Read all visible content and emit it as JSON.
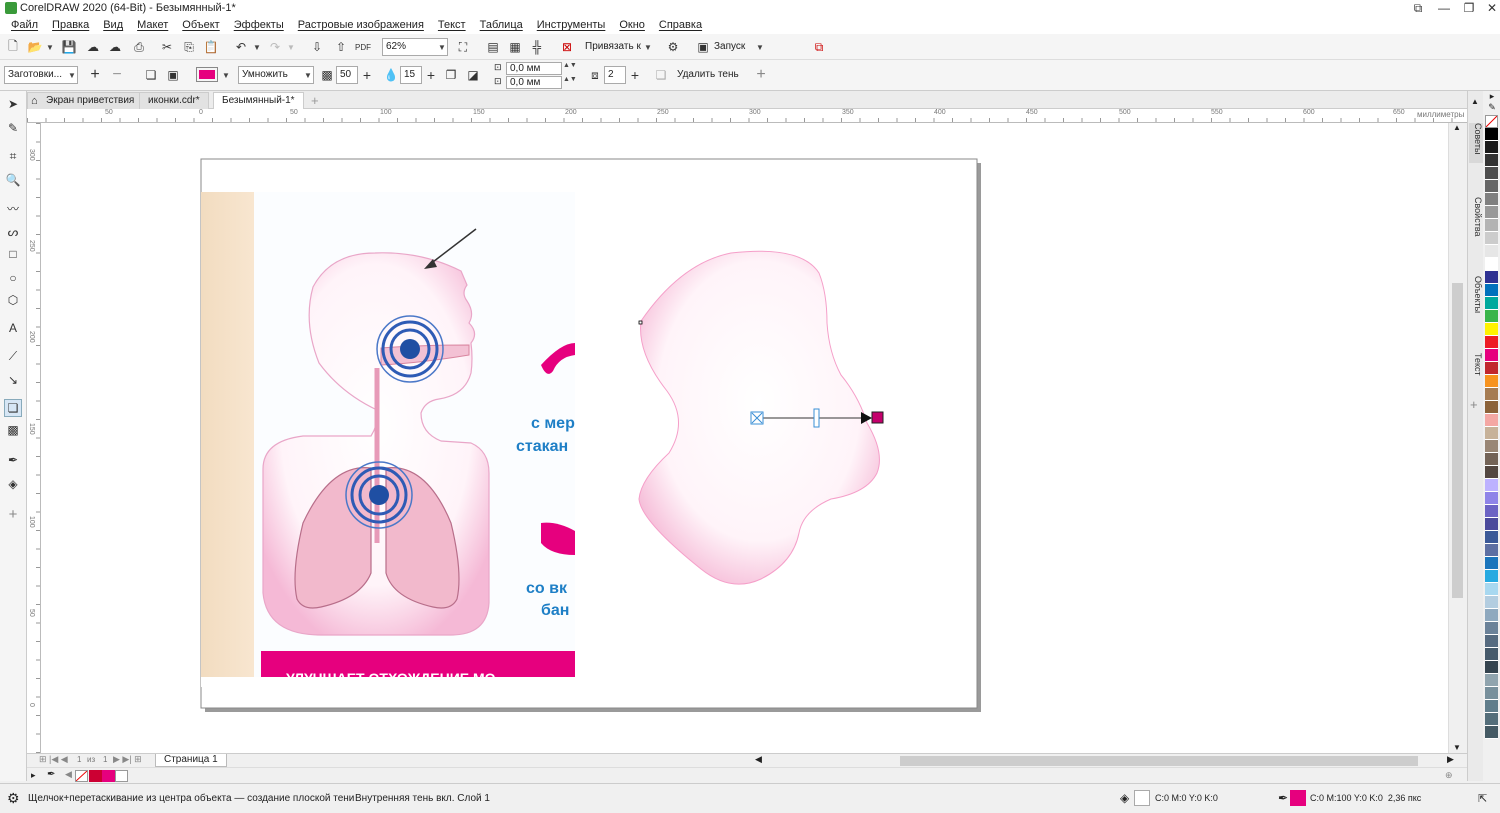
{
  "app": {
    "title": "CorelDRAW 2020 (64-Bit) - Безымянный-1*"
  },
  "menu": [
    "Файл",
    "Правка",
    "Вид",
    "Макет",
    "Объект",
    "Эффекты",
    "Растровые изображения",
    "Текст",
    "Таблица",
    "Инструменты",
    "Окно",
    "Справка"
  ],
  "toolbar1": {
    "zoom": "62%",
    "snap_label": "Привязать к",
    "launch_label": "Запуск"
  },
  "toolbar2": {
    "preset": "Заготовки...",
    "blend_mode": "Умножить",
    "opacity": "50",
    "feather": "15",
    "offset_x": "0,0 мм",
    "offset_y": "0,0 мм",
    "shadow_copies": "2",
    "remove_shadow": "Удалить тень",
    "shadow_color": "#e6007e"
  },
  "tabs": [
    {
      "label": "Экран приветствия"
    },
    {
      "label": "иконки.cdr*"
    },
    {
      "label": "Безымянный-1*"
    }
  ],
  "ruler": {
    "units": "миллиметры",
    "h_ticks": [
      "50",
      "0",
      "50",
      "100",
      "150",
      "200",
      "250",
      "300",
      "350",
      "400",
      "450",
      "500",
      "550",
      "600",
      "650"
    ],
    "v_ticks": [
      "300",
      "250",
      "200",
      "150",
      "100",
      "50",
      "0"
    ]
  },
  "artwork": {
    "text_line1": "с мер",
    "text_line2": "стакан",
    "text_line3": "со вк",
    "text_line4": "бан",
    "banner": "УЛУЧШАЕТ ОТХОЖДЕНИЕ МО"
  },
  "page_nav": {
    "current": "1",
    "of": "из",
    "total": "1",
    "page_tab": "Страница 1"
  },
  "dockers": [
    "Советы",
    "Свойства",
    "Объекты",
    "Текст"
  ],
  "palette": [
    "#ffffff",
    "#000000",
    "#1a1a1a",
    "#333333",
    "#4d4d4d",
    "#666666",
    "#808080",
    "#999999",
    "#b3b3b3",
    "#cccccc",
    "#e6e6e6",
    "#ffffff",
    "#2e3192",
    "#0071bc",
    "#00a99d",
    "#39b54a",
    "#fff200",
    "#ed1c24",
    "#e6007e",
    "#c1272d",
    "#f7931e",
    "#a67c52",
    "#8c6239",
    "#f4a7a3",
    "#c7b299",
    "#998675",
    "#736357",
    "#534741",
    "#bdb2ff",
    "#8f84e8",
    "#6c63c4",
    "#4b4a9c",
    "#3b5998",
    "#5d6fa3",
    "#1b75bc",
    "#27aae1",
    "#a8d8f0",
    "#b3cde0",
    "#8fa9bf",
    "#6b8299",
    "#566b80",
    "#465a6b",
    "#35444f",
    "#90a4ae",
    "#78909c",
    "#607d8b",
    "#546e7a",
    "#455a64"
  ],
  "palette_tray": {
    "stroke_color": "#cc0033",
    "fill_color": "#e6007e"
  },
  "status": {
    "hint": "Щелчок+перетаскивание из центра объекта — создание плоской тени",
    "object_info": "Внутренняя тень вкл. Слой 1",
    "fill_info": "C:0 M:0 Y:0 K:0",
    "outline_info": "C:0 M:100 Y:0 K:0  2,36 пкс",
    "outline_color": "#e6007e"
  }
}
